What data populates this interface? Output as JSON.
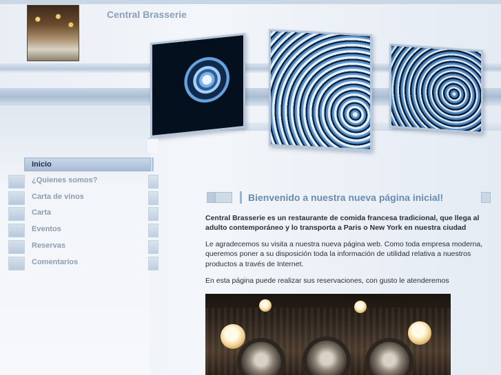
{
  "site": {
    "name": "Central Brasserie"
  },
  "menu": {
    "items": [
      {
        "label": "Inicio",
        "active": true
      },
      {
        "label": "¿Quienes somos?"
      },
      {
        "label": "Carta de vinos"
      },
      {
        "label": "Carta"
      },
      {
        "label": "Eventos"
      },
      {
        "label": "Reservas"
      },
      {
        "label": "Comentarios"
      }
    ]
  },
  "main": {
    "heading": "Bienvenido a nuestra nueva página inicial!",
    "lead": "Central Brasserie es un restaurante de comida francesa tradicional, que llega al adulto contemporáneo y lo transporta a Paris o New York en nuestra ciudad",
    "paragraph1": "Le agradecemos su visita a nuestra nueva página web. Como toda empresa moderna, queremos poner a su disposición toda la información de utilidad relativa a nuestros productos a través de Internet.",
    "paragraph2": "En esta página puede realizar sus reservaciones, con gusto le atenderemos"
  },
  "colors": {
    "accent": "#6a8bb0",
    "menu_text": "#8c9db1",
    "active_text": "#1f2f46"
  }
}
